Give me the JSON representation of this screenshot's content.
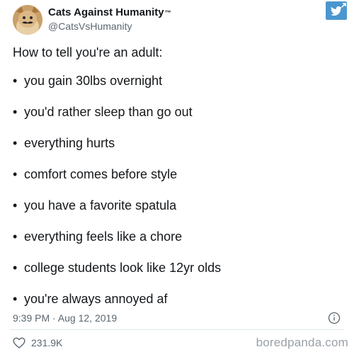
{
  "author": {
    "display_name": "Cats Against Humanity",
    "trademark": "™",
    "handle": "@CatsVsHumanity"
  },
  "tweet": {
    "intro": "How to tell you're an adult:",
    "bullet_symbol": "•",
    "items": [
      "you gain 30lbs overnight",
      "you'd rather sleep than go out",
      "everything hurts",
      "comfort comes before style",
      "you have a favorite spatula",
      "everything feels like a chore",
      "college students look like 12yr olds",
      "you're always annoyed af"
    ],
    "timestamp": "9:39 PM · Aug 12, 2019",
    "like_count": "231.9K"
  },
  "icons": {
    "badge": "twitter-bird-icon",
    "info": "info-icon",
    "like": "heart-icon",
    "badge_color": "#4a97cf"
  },
  "watermark": "boredpanda.com"
}
